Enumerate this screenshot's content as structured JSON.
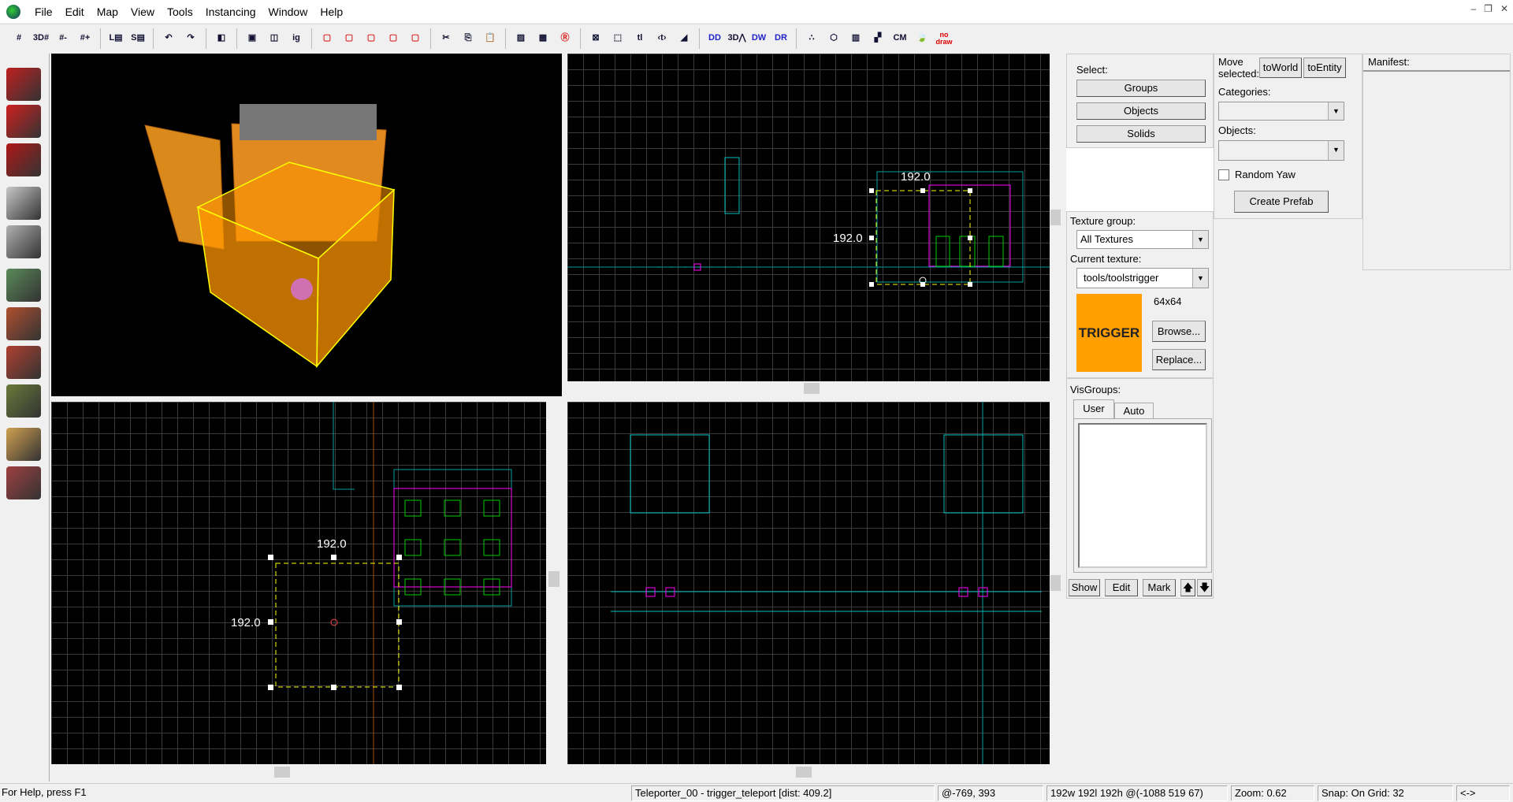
{
  "menu": [
    "File",
    "Edit",
    "Map",
    "View",
    "Tools",
    "Instancing",
    "Window",
    "Help"
  ],
  "window_controls": {
    "minimize": "‒",
    "restore": "❐",
    "close": "✕"
  },
  "toolbar": {
    "buttons": [
      {
        "name": "grid-toggle-icon",
        "glyph": "#"
      },
      {
        "name": "3d-grid-icon",
        "glyph": "3D#"
      },
      {
        "name": "smaller-grid-icon",
        "glyph": "#-"
      },
      {
        "name": "larger-grid-icon",
        "glyph": "#+"
      },
      {
        "sep": true
      },
      {
        "name": "load-window-state-icon",
        "glyph": "L▤"
      },
      {
        "name": "save-window-state-icon",
        "glyph": "S▤"
      },
      {
        "sep": true
      },
      {
        "name": "undo-icon",
        "glyph": "↶"
      },
      {
        "name": "redo-icon",
        "glyph": "↷"
      },
      {
        "sep": true
      },
      {
        "name": "carve-icon",
        "glyph": "◧"
      },
      {
        "sep": true
      },
      {
        "name": "group-icon",
        "glyph": "▣"
      },
      {
        "name": "ungroup-icon",
        "glyph": "◫"
      },
      {
        "name": "ignore-grouping-icon",
        "glyph": "ig"
      },
      {
        "sep": true
      },
      {
        "name": "hide-selected-icon",
        "glyph": "▢"
      },
      {
        "name": "hide-unselected-icon",
        "glyph": "▢"
      },
      {
        "name": "unhide-icon",
        "glyph": "▢"
      },
      {
        "name": "quick-hide-icon",
        "glyph": "▢"
      },
      {
        "name": "quick-unhide-icon",
        "glyph": "▢"
      },
      {
        "sep": true
      },
      {
        "name": "cut-icon",
        "glyph": "✂"
      },
      {
        "name": "copy-icon",
        "glyph": "⎘"
      },
      {
        "name": "paste-icon",
        "glyph": "📋"
      },
      {
        "sep": true
      },
      {
        "name": "tie-to-entity-icon",
        "glyph": "▨"
      },
      {
        "name": "move-to-world-icon",
        "glyph": "▩"
      },
      {
        "name": "radius-culling-icon",
        "glyph": "Ⓡ"
      },
      {
        "sep": true
      },
      {
        "name": "texture-lock-icon",
        "glyph": "⊠"
      },
      {
        "name": "selection-by-handles-icon",
        "glyph": "⬚"
      },
      {
        "name": "texture-lock-scale-icon",
        "glyph": "tl"
      },
      {
        "name": "texture-lock-flip-icon",
        "glyph": "‹t›"
      },
      {
        "name": "flip-icon",
        "glyph": "◢"
      },
      {
        "sep": true
      },
      {
        "name": "display-models-2d-icon",
        "glyph": "DD"
      },
      {
        "name": "3d-models-icon",
        "glyph": "3D⋀"
      },
      {
        "name": "display-walls-icon",
        "glyph": "DW"
      },
      {
        "name": "display-ropes-icon",
        "glyph": "DR"
      },
      {
        "sep": true
      },
      {
        "name": "display-helpers-icon",
        "glyph": "∴"
      },
      {
        "name": "toggle-wireframe-icon",
        "glyph": "⬡"
      },
      {
        "name": "toggle-textures-icon",
        "glyph": "▥"
      },
      {
        "name": "toggle-lightmap-icon",
        "glyph": "▞"
      },
      {
        "name": "cubemap-icon",
        "glyph": "CM"
      },
      {
        "name": "auto-visgroups-icon",
        "glyph": "🍃"
      },
      {
        "name": "nodraw-icon",
        "glyph": "no draw"
      }
    ]
  },
  "palette": [
    {
      "name": "selection-tool-icon",
      "color": "#c02020"
    },
    {
      "name": "magnify-tool-icon",
      "color": "#d02020"
    },
    {
      "name": "camera-tool-icon",
      "color": "#b01818"
    },
    {
      "name": "entity-tool-icon",
      "color": "#c8c8c8"
    },
    {
      "name": "block-tool-icon",
      "color": "#b0b0b0"
    },
    {
      "name": "texture-application-icon",
      "color": "#5a8a5a"
    },
    {
      "name": "apply-texture-icon",
      "color": "#b05030"
    },
    {
      "name": "decal-tool-icon",
      "color": "#b04030"
    },
    {
      "name": "overlay-tool-icon",
      "color": "#6a7a3a"
    },
    {
      "name": "clipping-tool-icon",
      "color": "#d0a050"
    },
    {
      "name": "vertex-tool-icon",
      "color": "#a04040"
    }
  ],
  "views": {
    "top": {
      "width_label": "192.0",
      "height_label": "192.0"
    },
    "side": {
      "width_label": "192.0",
      "height_label": "192.0"
    }
  },
  "select_panel": {
    "label": "Select:",
    "groups": "Groups",
    "objects": "Objects",
    "solids": "Solids"
  },
  "prefab_panel": {
    "move_label": "Move selected:",
    "to_world": "toWorld",
    "to_entity": "toEntity",
    "categories_label": "Categories:",
    "categories_value": "",
    "objects_label": "Objects:",
    "objects_value": "",
    "random_yaw": "Random Yaw",
    "random_yaw_checked": false,
    "create_prefab": "Create Prefab"
  },
  "manifest": {
    "label": "Manifest:"
  },
  "texture_panel": {
    "group_label": "Texture group:",
    "group_value": "All Textures",
    "current_label": "Current texture:",
    "current_value": "tools/toolstrigger",
    "preview_text": "TRIGGER",
    "preview_color": "#ff9f00",
    "size": "64x64",
    "browse": "Browse...",
    "replace": "Replace..."
  },
  "visgroups": {
    "label": "VisGroups:",
    "tabs": [
      "User",
      "Auto"
    ],
    "show": "Show",
    "edit": "Edit",
    "mark": "Mark",
    "up": "🡅",
    "down": "🡇"
  },
  "status": {
    "help": "For Help, press F1",
    "selection": "Teleporter_00 - trigger_teleport  [dist: 409.2]",
    "cursor": "@-769, 393",
    "size": "192w 192l 192h @(-1088 519 67)",
    "zoom": "Zoom: 0.62",
    "snap": "Snap: On Grid: 32",
    "arrows": "<->"
  },
  "colors": {
    "selection": "#ffff00",
    "brush_trigger": "#ff9f00",
    "entity": "#ff00ff",
    "grid": "#3a3a3a",
    "axis": "#00a0a0"
  }
}
